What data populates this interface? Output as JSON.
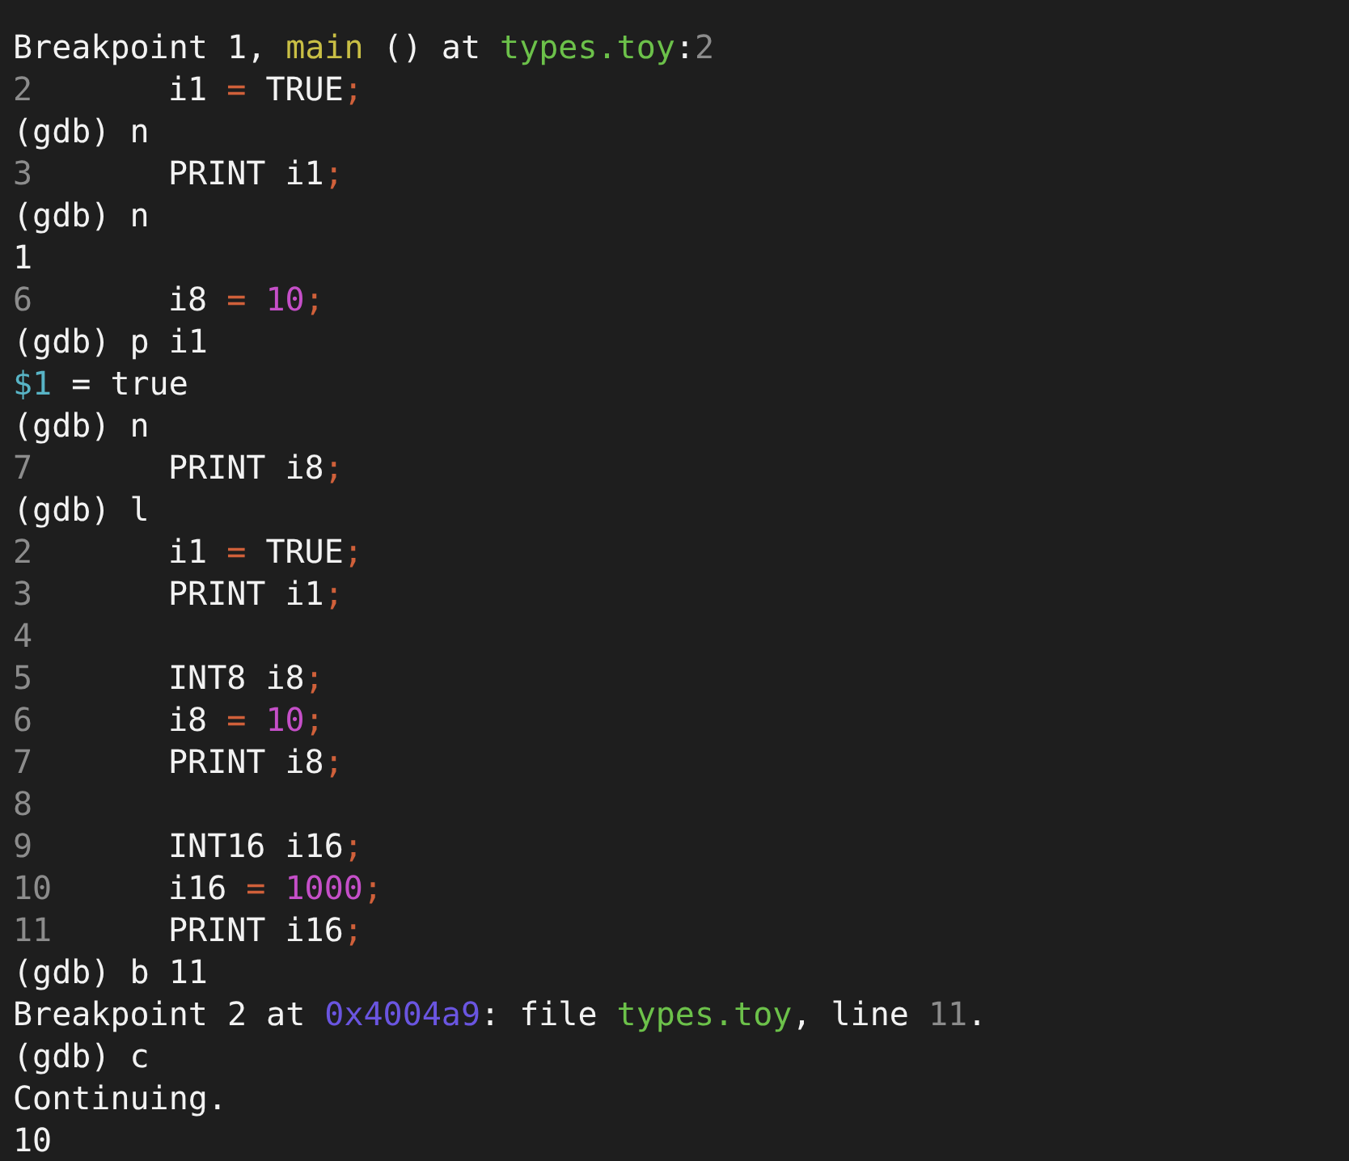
{
  "lines": [
    {
      "kind": "output",
      "segments": [
        {
          "text": "Breakpoint 1, ",
          "color": "#f2f2f2"
        },
        {
          "text": "main",
          "color": "#c9bf45"
        },
        {
          "text": " () at ",
          "color": "#f2f2f2"
        },
        {
          "text": "types.toy",
          "color": "#6cc14a"
        },
        {
          "text": ":",
          "color": "#f2f2f2"
        },
        {
          "text": "2",
          "color": "#8c8c8c"
        }
      ]
    },
    {
      "kind": "source",
      "number": "2",
      "segments": [
        {
          "text": "i1 ",
          "color": "#f2f2f2"
        },
        {
          "text": "=",
          "color": "#d0603a"
        },
        {
          "text": " TRUE",
          "color": "#f2f2f2"
        },
        {
          "text": ";",
          "color": "#d0603a"
        }
      ]
    },
    {
      "kind": "output",
      "segments": [
        {
          "text": "(gdb) n",
          "color": "#f2f2f2"
        }
      ]
    },
    {
      "kind": "source",
      "number": "3",
      "segments": [
        {
          "text": "PRINT i1",
          "color": "#f2f2f2"
        },
        {
          "text": ";",
          "color": "#d0603a"
        }
      ]
    },
    {
      "kind": "output",
      "segments": [
        {
          "text": "(gdb) n",
          "color": "#f2f2f2"
        }
      ]
    },
    {
      "kind": "output",
      "segments": [
        {
          "text": "1",
          "color": "#f2f2f2"
        }
      ]
    },
    {
      "kind": "source",
      "number": "6",
      "segments": [
        {
          "text": "i8 ",
          "color": "#f2f2f2"
        },
        {
          "text": "= ",
          "color": "#d0603a"
        },
        {
          "text": "10",
          "color": "#c54fc8"
        },
        {
          "text": ";",
          "color": "#d0603a"
        }
      ]
    },
    {
      "kind": "output",
      "segments": [
        {
          "text": "(gdb) p i1",
          "color": "#f2f2f2"
        }
      ]
    },
    {
      "kind": "output",
      "segments": [
        {
          "text": "$1",
          "color": "#58b4c6"
        },
        {
          "text": " = true",
          "color": "#f2f2f2"
        }
      ]
    },
    {
      "kind": "output",
      "segments": [
        {
          "text": "(gdb) n",
          "color": "#f2f2f2"
        }
      ]
    },
    {
      "kind": "source",
      "number": "7",
      "segments": [
        {
          "text": "PRINT i8",
          "color": "#f2f2f2"
        },
        {
          "text": ";",
          "color": "#d0603a"
        }
      ]
    },
    {
      "kind": "output",
      "segments": [
        {
          "text": "(gdb) l",
          "color": "#f2f2f2"
        }
      ]
    },
    {
      "kind": "source",
      "number": "2",
      "segments": [
        {
          "text": "i1 ",
          "color": "#f2f2f2"
        },
        {
          "text": "=",
          "color": "#d0603a"
        },
        {
          "text": " TRUE",
          "color": "#f2f2f2"
        },
        {
          "text": ";",
          "color": "#d0603a"
        }
      ]
    },
    {
      "kind": "source",
      "number": "3",
      "segments": [
        {
          "text": "PRINT i1",
          "color": "#f2f2f2"
        },
        {
          "text": ";",
          "color": "#d0603a"
        }
      ]
    },
    {
      "kind": "source",
      "number": "4"
    },
    {
      "kind": "source",
      "number": "5",
      "segments": [
        {
          "text": "INT8 i8",
          "color": "#f2f2f2"
        },
        {
          "text": ";",
          "color": "#d0603a"
        }
      ]
    },
    {
      "kind": "source",
      "number": "6",
      "segments": [
        {
          "text": "i8 ",
          "color": "#f2f2f2"
        },
        {
          "text": "= ",
          "color": "#d0603a"
        },
        {
          "text": "10",
          "color": "#c54fc8"
        },
        {
          "text": ";",
          "color": "#d0603a"
        }
      ]
    },
    {
      "kind": "source",
      "number": "7",
      "segments": [
        {
          "text": "PRINT i8",
          "color": "#f2f2f2"
        },
        {
          "text": ";",
          "color": "#d0603a"
        }
      ]
    },
    {
      "kind": "source",
      "number": "8"
    },
    {
      "kind": "source",
      "number": "9",
      "segments": [
        {
          "text": "INT16 i16",
          "color": "#f2f2f2"
        },
        {
          "text": ";",
          "color": "#d0603a"
        }
      ]
    },
    {
      "kind": "source",
      "number": "10",
      "segments": [
        {
          "text": "i16 ",
          "color": "#f2f2f2"
        },
        {
          "text": "= ",
          "color": "#d0603a"
        },
        {
          "text": "1000",
          "color": "#c54fc8"
        },
        {
          "text": ";",
          "color": "#d0603a"
        }
      ]
    },
    {
      "kind": "source",
      "number": "11",
      "segments": [
        {
          "text": "PRINT i16",
          "color": "#f2f2f2"
        },
        {
          "text": ";",
          "color": "#d0603a"
        }
      ]
    },
    {
      "kind": "output",
      "segments": [
        {
          "text": "(gdb) b 11",
          "color": "#f2f2f2"
        }
      ]
    },
    {
      "kind": "output",
      "segments": [
        {
          "text": "Breakpoint 2 at ",
          "color": "#f2f2f2"
        },
        {
          "text": "0x4004a9",
          "color": "#6a55e0"
        },
        {
          "text": ": file ",
          "color": "#f2f2f2"
        },
        {
          "text": "types.toy",
          "color": "#6cc14a"
        },
        {
          "text": ", line ",
          "color": "#f2f2f2"
        },
        {
          "text": "11",
          "color": "#8c8c8c"
        },
        {
          "text": ".",
          "color": "#f2f2f2"
        }
      ]
    },
    {
      "kind": "output",
      "segments": [
        {
          "text": "(gdb) c",
          "color": "#f2f2f2"
        }
      ]
    },
    {
      "kind": "output",
      "segments": [
        {
          "text": "Continuing.",
          "color": "#f2f2f2"
        }
      ]
    },
    {
      "kind": "output",
      "segments": [
        {
          "text": "10",
          "color": "#f2f2f2"
        }
      ]
    }
  ]
}
